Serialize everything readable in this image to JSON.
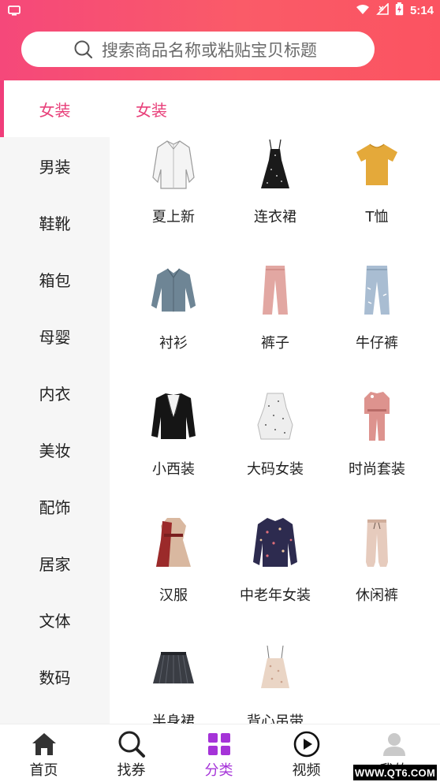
{
  "status_bar": {
    "time": "5:14"
  },
  "search": {
    "placeholder": "搜索商品名称或粘贴宝贝标题"
  },
  "sidebar": {
    "items": [
      {
        "label": "女装",
        "active": true
      },
      {
        "label": "男装"
      },
      {
        "label": "鞋靴"
      },
      {
        "label": "箱包"
      },
      {
        "label": "母婴"
      },
      {
        "label": "内衣"
      },
      {
        "label": "美妆"
      },
      {
        "label": "配饰"
      },
      {
        "label": "居家"
      },
      {
        "label": "文体"
      },
      {
        "label": "数码"
      }
    ]
  },
  "content": {
    "title": "女装",
    "items": [
      {
        "label": "夏上新",
        "icon": "white-shirt-icon"
      },
      {
        "label": "连衣裙",
        "icon": "black-dress-icon"
      },
      {
        "label": "T恤",
        "icon": "yellow-tshirt-icon"
      },
      {
        "label": "衬衫",
        "icon": "blue-blouse-icon"
      },
      {
        "label": "裤子",
        "icon": "pink-pants-icon"
      },
      {
        "label": "牛仔裤",
        "icon": "jeans-icon"
      },
      {
        "label": "小西装",
        "icon": "black-blazer-icon"
      },
      {
        "label": "大码女装",
        "icon": "dotted-skirt-icon"
      },
      {
        "label": "时尚套装",
        "icon": "pink-suit-icon"
      },
      {
        "label": "汉服",
        "icon": "hanfu-icon"
      },
      {
        "label": "中老年女装",
        "icon": "floral-coat-icon"
      },
      {
        "label": "休闲裤",
        "icon": "casual-pants-icon"
      },
      {
        "label": "半身裙",
        "icon": "pleated-skirt-icon"
      },
      {
        "label": "背心吊带",
        "icon": "camisole-icon"
      }
    ]
  },
  "tabbar": {
    "items": [
      {
        "label": "首页",
        "icon": "home-icon"
      },
      {
        "label": "找券",
        "icon": "search-icon"
      },
      {
        "label": "分类",
        "icon": "grid-icon",
        "active": true
      },
      {
        "label": "视频",
        "icon": "play-icon"
      },
      {
        "label": "我的",
        "icon": "user-icon"
      }
    ]
  },
  "colors": {
    "accent": "#e8407a",
    "tab_active": "#a533d8",
    "header_start": "#f5487a",
    "header_end": "#fb5361"
  },
  "watermark": "WWW.QT6.COM"
}
